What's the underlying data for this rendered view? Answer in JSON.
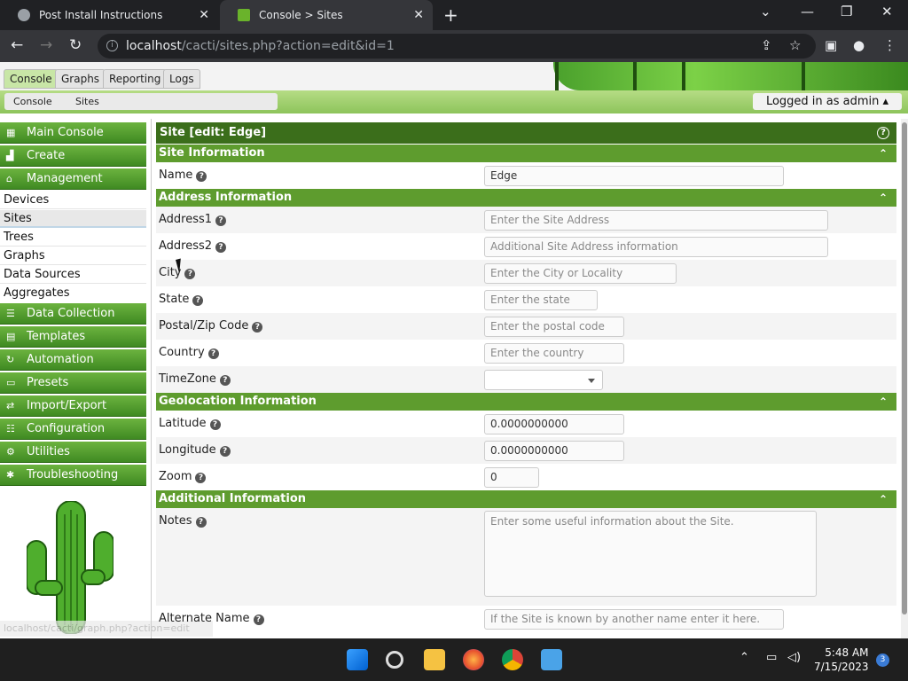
{
  "browser": {
    "tabs": [
      {
        "title": "Post Install Instructions"
      },
      {
        "title": "Console > Sites"
      }
    ],
    "url_host": "localhost",
    "url_path": "/cacti/sites.php?action=edit&id=1"
  },
  "cacti": {
    "main_tabs": [
      "Console",
      "Graphs",
      "Reporting",
      "Logs"
    ],
    "breadcrumbs": [
      "Console",
      "Sites"
    ],
    "login_status": "Logged in as admin ▴"
  },
  "sidebar": {
    "headers_top": [
      "Main Console",
      "Create",
      "Management"
    ],
    "management_items": [
      "Devices",
      "Sites",
      "Trees",
      "Graphs",
      "Data Sources",
      "Aggregates"
    ],
    "headers_bottom": [
      "Data Collection",
      "Templates",
      "Automation",
      "Presets",
      "Import/Export",
      "Configuration",
      "Utilities",
      "Troubleshooting"
    ],
    "status_url": "localhost/cacti/graph.php?action=edit"
  },
  "form": {
    "title": "Site [edit: Edge]",
    "sections": {
      "site": "Site Information",
      "address": "Address Information",
      "geo": "Geolocation Information",
      "additional": "Additional Information"
    },
    "fields": {
      "name": {
        "label": "Name",
        "value": "Edge"
      },
      "address1": {
        "label": "Address1",
        "placeholder": "Enter the Site Address"
      },
      "address2": {
        "label": "Address2",
        "placeholder": "Additional Site Address information"
      },
      "city": {
        "label": "City",
        "placeholder": "Enter the City or Locality"
      },
      "state": {
        "label": "State",
        "placeholder": "Enter the state"
      },
      "postal": {
        "label": "Postal/Zip Code",
        "placeholder": "Enter the postal code"
      },
      "country": {
        "label": "Country",
        "placeholder": "Enter the country"
      },
      "timezone": {
        "label": "TimeZone",
        "value": ""
      },
      "latitude": {
        "label": "Latitude",
        "value": "0.0000000000"
      },
      "longitude": {
        "label": "Longitude",
        "value": "0.0000000000"
      },
      "zoom": {
        "label": "Zoom",
        "value": "0"
      },
      "notes": {
        "label": "Notes",
        "placeholder": "Enter some useful information about the Site."
      },
      "alternate": {
        "label": "Alternate Name",
        "placeholder": "If the Site is known by another name enter it here."
      }
    }
  },
  "taskbar": {
    "time": "5:48 AM",
    "date": "7/15/2023",
    "notifications": "3"
  }
}
